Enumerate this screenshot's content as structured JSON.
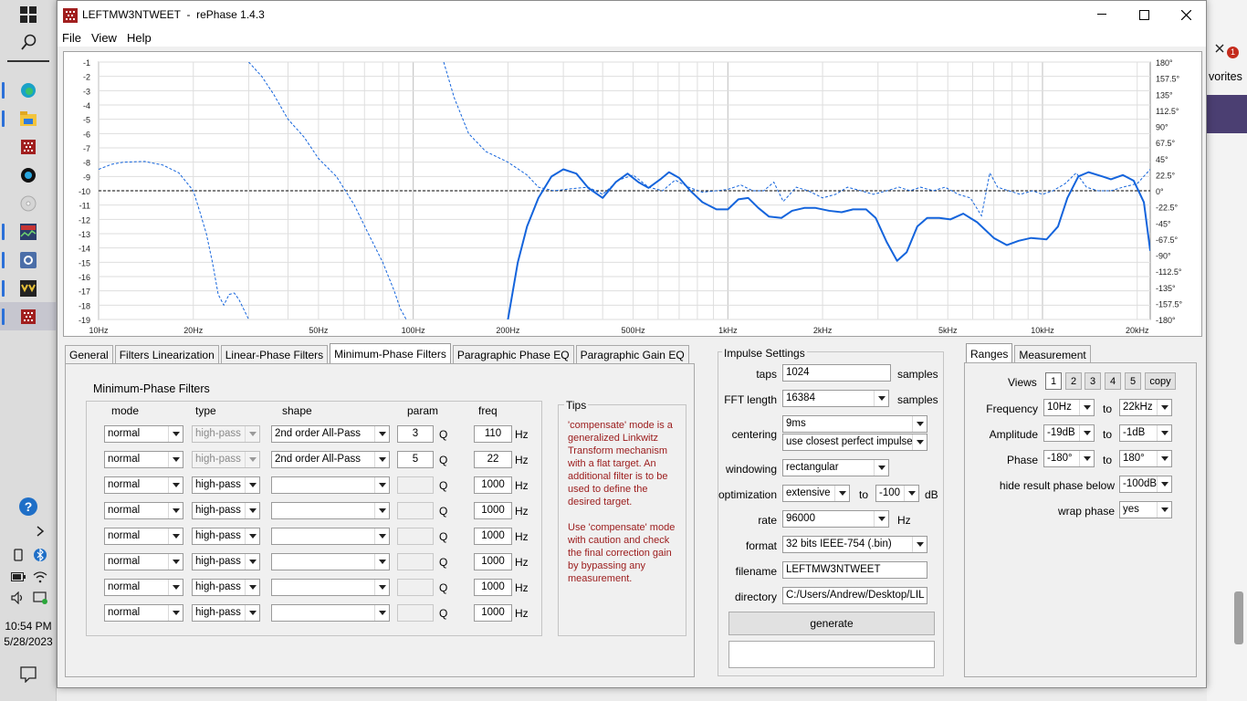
{
  "taskbar": {
    "icons": [
      "windows-icon",
      "search-icon",
      "edge-icon",
      "file-explorer-icon",
      "rephase-icon",
      "media-player-icon",
      "cd-icon",
      "rew-icon",
      "settings-app-icon",
      "voicemeeter-icon",
      "rephase-active-icon"
    ],
    "tray": {
      "time": "10:54 PM",
      "date": "5/28/2023"
    }
  },
  "background": {
    "right_text": "vorites",
    "badge": "1"
  },
  "window": {
    "title": "LEFTMW3NTWEET  -  rePhase 1.4.3",
    "menu": [
      "File",
      "View",
      "Help"
    ]
  },
  "graph": {
    "y_left_ticks": [
      "-1",
      "-2",
      "-3",
      "-4",
      "-5",
      "-6",
      "-7",
      "-8",
      "-9",
      "-10",
      "-11",
      "-12",
      "-13",
      "-14",
      "-15",
      "-16",
      "-17",
      "-18",
      "-19"
    ],
    "y_right_ticks": [
      "180°",
      "157.5°",
      "135°",
      "112.5°",
      "90°",
      "67.5°",
      "45°",
      "22.5°",
      "0°",
      "-22.5°",
      "-45°",
      "-67.5°",
      "-90°",
      "-112.5°",
      "-135°",
      "-157.5°",
      "-180°"
    ],
    "x_ticks": [
      {
        "f": 10,
        "l": "10Hz"
      },
      {
        "f": 20,
        "l": "20Hz"
      },
      {
        "f": 50,
        "l": "50Hz"
      },
      {
        "f": 100,
        "l": "100Hz"
      },
      {
        "f": 200,
        "l": "200Hz"
      },
      {
        "f": 500,
        "l": "500Hz"
      },
      {
        "f": 1000,
        "l": "1kHz"
      },
      {
        "f": 2000,
        "l": "2kHz"
      },
      {
        "f": 5000,
        "l": "5kHz"
      },
      {
        "f": 10000,
        "l": "10kHz"
      },
      {
        "f": 20000,
        "l": "20kHz"
      }
    ],
    "x_range_hz": [
      10,
      22000
    ],
    "y_range_db": [
      -19,
      -1
    ],
    "phase_range_deg": [
      -180,
      180
    ],
    "target_db": -10,
    "magnitude": [
      [
        200,
        -19
      ],
      [
        215,
        -15
      ],
      [
        230,
        -12.5
      ],
      [
        250,
        -10.5
      ],
      [
        275,
        -9
      ],
      [
        300,
        -8.5
      ],
      [
        330,
        -8.8
      ],
      [
        360,
        -9.8
      ],
      [
        400,
        -10.5
      ],
      [
        440,
        -9.4
      ],
      [
        480,
        -8.8
      ],
      [
        520,
        -9.4
      ],
      [
        560,
        -9.8
      ],
      [
        610,
        -9.2
      ],
      [
        650,
        -8.7
      ],
      [
        700,
        -9.1
      ],
      [
        760,
        -10
      ],
      [
        830,
        -10.8
      ],
      [
        920,
        -11.3
      ],
      [
        1000,
        -11.3
      ],
      [
        1080,
        -10.6
      ],
      [
        1160,
        -10.5
      ],
      [
        1250,
        -11.2
      ],
      [
        1350,
        -11.8
      ],
      [
        1480,
        -11.9
      ],
      [
        1600,
        -11.4
      ],
      [
        1750,
        -11.2
      ],
      [
        1900,
        -11.2
      ],
      [
        2100,
        -11.4
      ],
      [
        2300,
        -11.5
      ],
      [
        2500,
        -11.3
      ],
      [
        2750,
        -11.3
      ],
      [
        2950,
        -11.9
      ],
      [
        3200,
        -13.6
      ],
      [
        3450,
        -14.9
      ],
      [
        3700,
        -14.3
      ],
      [
        4000,
        -12.5
      ],
      [
        4300,
        -11.9
      ],
      [
        4700,
        -11.9
      ],
      [
        5100,
        -12
      ],
      [
        5600,
        -11.6
      ],
      [
        6200,
        -12.2
      ],
      [
        7000,
        -13.3
      ],
      [
        7700,
        -13.8
      ],
      [
        8400,
        -13.5
      ],
      [
        9200,
        -13.3
      ],
      [
        10300,
        -13.4
      ],
      [
        11200,
        -12.5
      ],
      [
        12000,
        -10.5
      ],
      [
        13000,
        -9
      ],
      [
        14000,
        -8.7
      ],
      [
        15500,
        -9
      ],
      [
        16500,
        -9.2
      ],
      [
        18000,
        -8.9
      ],
      [
        19500,
        -9.3
      ],
      [
        21000,
        -10.8
      ],
      [
        22000,
        -14.2
      ]
    ],
    "phase": [
      [
        10,
        30
      ],
      [
        11,
        37
      ],
      [
        12,
        40
      ],
      [
        14,
        41
      ],
      [
        16,
        36
      ],
      [
        18,
        25
      ],
      [
        20,
        0
      ],
      [
        21,
        -30
      ],
      [
        22,
        -60
      ],
      [
        23,
        -100
      ],
      [
        24,
        -145
      ],
      [
        25,
        -160
      ],
      [
        26,
        -145
      ],
      [
        27,
        -143
      ],
      [
        28,
        -153
      ],
      [
        30,
        -180
      ],
      null,
      [
        30,
        180
      ],
      [
        33,
        160
      ],
      [
        36,
        135
      ],
      [
        40,
        100
      ],
      [
        45,
        75
      ],
      [
        50,
        45
      ],
      [
        57,
        20
      ],
      [
        65,
        -20
      ],
      [
        72,
        -60
      ],
      [
        80,
        -100
      ],
      [
        87,
        -140
      ],
      [
        91,
        -165
      ],
      [
        95,
        -180
      ],
      null,
      [
        125,
        180
      ],
      [
        135,
        130
      ],
      [
        150,
        80
      ],
      [
        170,
        55
      ],
      [
        200,
        40
      ],
      [
        230,
        22
      ],
      [
        250,
        5
      ],
      [
        280,
        0
      ],
      [
        320,
        3
      ],
      [
        360,
        5
      ],
      [
        400,
        -5
      ],
      [
        450,
        15
      ],
      [
        500,
        22
      ],
      [
        560,
        5
      ],
      [
        620,
        0
      ],
      [
        680,
        15
      ],
      [
        750,
        5
      ],
      [
        830,
        -2
      ],
      [
        920,
        0
      ],
      [
        1000,
        2
      ],
      [
        1100,
        8
      ],
      [
        1200,
        0
      ],
      [
        1300,
        0
      ],
      [
        1400,
        12
      ],
      [
        1500,
        -15
      ],
      [
        1650,
        5
      ],
      [
        1800,
        0
      ],
      [
        2000,
        -10
      ],
      [
        2200,
        -5
      ],
      [
        2400,
        5
      ],
      [
        2650,
        0
      ],
      [
        2900,
        -5
      ],
      [
        3200,
        0
      ],
      [
        3500,
        5
      ],
      [
        3800,
        0
      ],
      [
        4100,
        5
      ],
      [
        4500,
        0
      ],
      [
        4900,
        5
      ],
      [
        5400,
        -5
      ],
      [
        5900,
        -10
      ],
      [
        6400,
        -35
      ],
      [
        6800,
        25
      ],
      [
        7200,
        5
      ],
      [
        7800,
        0
      ],
      [
        8500,
        -5
      ],
      [
        9300,
        0
      ],
      [
        10000,
        -5
      ],
      [
        10800,
        0
      ],
      [
        11800,
        10
      ],
      [
        12800,
        25
      ],
      [
        13800,
        5
      ],
      [
        15000,
        0
      ],
      [
        16500,
        0
      ],
      [
        18000,
        5
      ],
      [
        20000,
        10
      ],
      [
        22000,
        30
      ]
    ]
  },
  "tabs": [
    "General",
    "Filters Linearization",
    "Linear-Phase Filters",
    "Minimum-Phase Filters",
    "Paragraphic Phase EQ",
    "Paragraphic Gain EQ"
  ],
  "active_tab": "Minimum-Phase Filters",
  "min_phase": {
    "title": "Minimum-Phase Filters",
    "headers": {
      "mode": "mode",
      "type": "type",
      "shape": "shape",
      "param": "param",
      "freq": "freq"
    },
    "q_unit": "Q",
    "hz_unit": "Hz",
    "rows": [
      {
        "mode": "normal",
        "type": "high-pass",
        "type_disabled": true,
        "shape": "2nd order All-Pass",
        "param": "3",
        "freq": "110"
      },
      {
        "mode": "normal",
        "type": "high-pass",
        "type_disabled": true,
        "shape": "2nd order All-Pass",
        "param": "5",
        "freq": "22"
      },
      {
        "mode": "normal",
        "type": "high-pass",
        "type_disabled": false,
        "shape": "",
        "param": "",
        "freq": "1000"
      },
      {
        "mode": "normal",
        "type": "high-pass",
        "type_disabled": false,
        "shape": "",
        "param": "",
        "freq": "1000"
      },
      {
        "mode": "normal",
        "type": "high-pass",
        "type_disabled": false,
        "shape": "",
        "param": "",
        "freq": "1000"
      },
      {
        "mode": "normal",
        "type": "high-pass",
        "type_disabled": false,
        "shape": "",
        "param": "",
        "freq": "1000"
      },
      {
        "mode": "normal",
        "type": "high-pass",
        "type_disabled": false,
        "shape": "",
        "param": "",
        "freq": "1000"
      },
      {
        "mode": "normal",
        "type": "high-pass",
        "type_disabled": false,
        "shape": "",
        "param": "",
        "freq": "1000"
      }
    ]
  },
  "tips": {
    "title": "Tips",
    "lines": [
      "'compensate' mode is a",
      "generalized Linkwitz",
      "Transform mechanism",
      "with a flat target. An",
      "additional filter is to be",
      "used to define the",
      "desired target.",
      "",
      "Use 'compensate' mode",
      "with caution and check",
      "the final correction gain",
      "by bypassing any",
      "measurement."
    ],
    "color": "#9b1b1b"
  },
  "impulse": {
    "title": "Impulse Settings",
    "taps_label": "taps",
    "taps": "1024",
    "taps_unit": "samples",
    "fft_label": "FFT length",
    "fft": "16384",
    "fft_unit": "samples",
    "centering_label": "centering",
    "centering": "9ms",
    "centering_mode": "use closest perfect impulse",
    "windowing_label": "windowing",
    "windowing": "rectangular",
    "optimization_label": "optimization",
    "optimization": "extensive",
    "opt_to": "to",
    "opt_db": "-100",
    "opt_unit": "dB",
    "rate_label": "rate",
    "rate": "96000",
    "rate_unit": "Hz",
    "format_label": "format",
    "format": "32 bits IEEE-754 (.bin)",
    "filename_label": "filename",
    "filename": "LEFTMW3NTWEET",
    "directory_label": "directory",
    "directory": "C:/Users/Andrew/Desktop/LIL H",
    "generate": "generate"
  },
  "ranges": {
    "tabs": [
      "Ranges",
      "Measurement"
    ],
    "views_label": "Views",
    "views": [
      "1",
      "2",
      "3",
      "4",
      "5"
    ],
    "copy": "copy",
    "frequency_label": "Frequency",
    "freq_from": "10Hz",
    "freq_to": "22kHz",
    "amplitude_label": "Amplitude",
    "amp_from": "-19dB",
    "amp_to": "-1dB",
    "phase_label": "Phase",
    "phase_from": "-180°",
    "phase_to": "180°",
    "to": "to",
    "hide_label": "hide result phase below",
    "hide": "-100dB",
    "wrap_label": "wrap phase",
    "wrap": "yes"
  },
  "colors": {
    "curve": "#1464dc",
    "target": "#000000",
    "grid": "#d8d8d8"
  }
}
